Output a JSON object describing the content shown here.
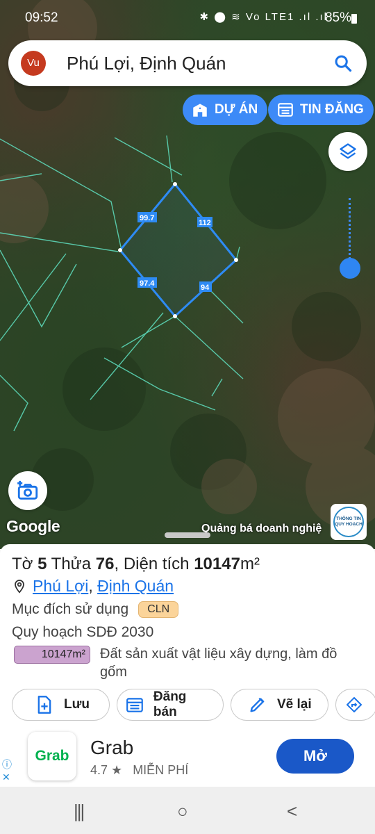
{
  "status_bar": {
    "time": "09:52",
    "icons": "✱ ⬤ ≋ Vo LTE1 .ıl .ıl",
    "battery": "85%"
  },
  "search": {
    "avatar": "Vu",
    "query": "Phú Lợi, Định Quán",
    "icon": "search-icon"
  },
  "map_buttons": {
    "projects": "DỰ ÁN",
    "listings": "TIN ĐĂNG",
    "layers_icon": "layers-icon",
    "camera_icon": "add-photo-icon"
  },
  "map": {
    "google": "Google",
    "promo": "Quảng bá doanh nghiệ",
    "badge_line1": "THÔNG TIN",
    "badge_line2": "QUY HOẠCH",
    "edges": [
      "99.7",
      "112",
      "97.4",
      "94"
    ]
  },
  "parcel": {
    "sheet_label": "Tờ",
    "sheet_no": "5",
    "lot_label": "Thửa",
    "lot_no": "76",
    "area_label": "Diện tích",
    "area_value": "10147",
    "area_unit": "m²",
    "commune": "Phú Lợi",
    "district": "Định Quán",
    "purpose_label": "Mục đích sử dụng",
    "purpose_code": "CLN",
    "plan_label": "Quy hoạch SDĐ 2030",
    "plan_area": "10147m²",
    "plan_desc": "Đất sản xuất vật liệu xây dựng, làm đồ gốm"
  },
  "actions": [
    {
      "label": "Lưu",
      "icon": "add-file-icon"
    },
    {
      "label": "Đăng bán",
      "icon": "calendar-list-icon"
    },
    {
      "label": "Vẽ lại",
      "icon": "edit-icon"
    },
    {
      "label": "",
      "icon": "directions-icon"
    }
  ],
  "ad": {
    "logo_text": "Grab",
    "name": "Grab",
    "rating": "4.7 ★",
    "price": "MIỄN PHÍ",
    "cta": "Mở"
  },
  "nav": {
    "recent": "|||",
    "home": "○",
    "back": "<"
  }
}
